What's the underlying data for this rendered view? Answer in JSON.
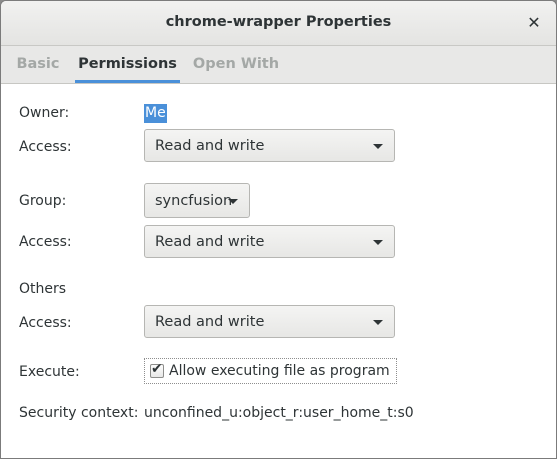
{
  "window": {
    "title": "chrome-wrapper Properties",
    "close_glyph": "✕"
  },
  "tabs": [
    {
      "label": "Basic",
      "active": false
    },
    {
      "label": "Permissions",
      "active": true
    },
    {
      "label": "Open With",
      "active": false
    }
  ],
  "permissions": {
    "owner_label": "Owner:",
    "owner_value": "Me",
    "owner_access_label": "Access:",
    "owner_access_value": "Read and write",
    "group_label": "Group:",
    "group_value": "syncfusion",
    "group_access_label": "Access:",
    "group_access_value": "Read and write",
    "others_label": "Others",
    "others_access_label": "Access:",
    "others_access_value": "Read and write",
    "execute_label": "Execute:",
    "execute_checkbox_label": "Allow executing file as program",
    "execute_checked": true,
    "security_label": "Security context:",
    "security_value": "unconfined_u:object_r:user_home_t:s0"
  },
  "colors": {
    "accent": "#4a90d9",
    "text": "#2e3436",
    "inactive_tab": "#a4a8a6"
  }
}
